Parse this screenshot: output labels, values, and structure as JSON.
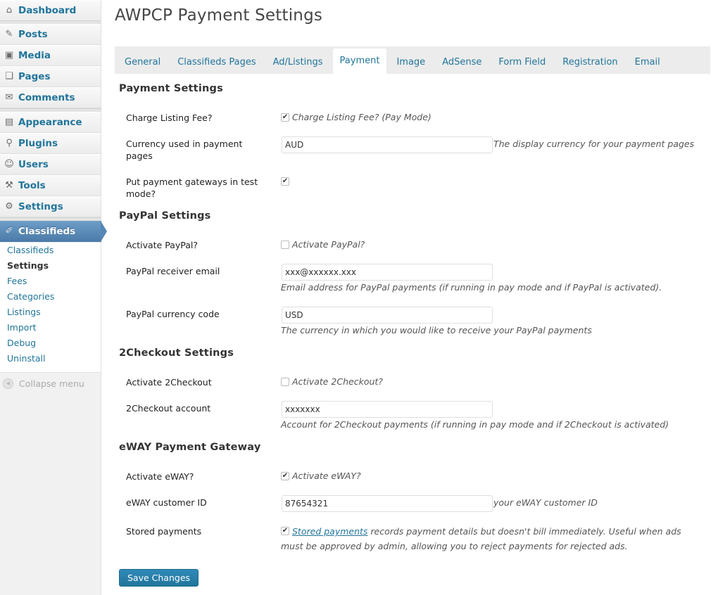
{
  "sidebar": {
    "items": [
      {
        "label": "Dashboard",
        "icon": "dashboard-icon"
      },
      {
        "label": "Posts",
        "icon": "posts-icon"
      },
      {
        "label": "Media",
        "icon": "media-icon"
      },
      {
        "label": "Pages",
        "icon": "pages-icon"
      },
      {
        "label": "Comments",
        "icon": "comments-icon"
      },
      {
        "label": "Appearance",
        "icon": "appearance-icon"
      },
      {
        "label": "Plugins",
        "icon": "plugins-icon"
      },
      {
        "label": "Users",
        "icon": "users-icon"
      },
      {
        "label": "Tools",
        "icon": "tools-icon"
      },
      {
        "label": "Settings",
        "icon": "settings-icon"
      },
      {
        "label": "Classifieds",
        "icon": "classifieds-icon"
      }
    ],
    "submenu": [
      "Classifieds",
      "Settings",
      "Fees",
      "Categories",
      "Listings",
      "Import",
      "Debug",
      "Uninstall"
    ],
    "collapse_label": "Collapse menu"
  },
  "page": {
    "title": "AWPCP Payment Settings"
  },
  "tabs": [
    "General",
    "Classifieds Pages",
    "Ad/Listings",
    "Payment",
    "Image",
    "AdSense",
    "Form Field",
    "Registration",
    "Email"
  ],
  "active_tab": "Payment",
  "sections": {
    "payment": {
      "title": "Payment Settings",
      "charge_fee_label": "Charge Listing Fee?",
      "charge_fee_text": "Charge Listing Fee? (Pay Mode)",
      "charge_fee_checked": true,
      "currency_label": "Currency used in payment pages",
      "currency_value": "AUD",
      "currency_desc": "The display currency for your payment pages",
      "test_mode_label": "Put payment gateways in test mode?",
      "test_mode_checked": true
    },
    "paypal": {
      "title": "PayPal Settings",
      "activate_label": "Activate PayPal?",
      "activate_text": "Activate PayPal?",
      "activate_checked": false,
      "email_label": "PayPal receiver email",
      "email_value": "xxx@xxxxxx.xxx",
      "email_desc": "Email address for PayPal payments (if running in pay mode and if PayPal is activated).",
      "currency_label": "PayPal currency code",
      "currency_value": "USD",
      "currency_desc": "The currency in which you would like to receive your PayPal payments"
    },
    "twocheckout": {
      "title": "2Checkout Settings",
      "activate_label": "Activate 2Checkout",
      "activate_text": "Activate 2Checkout?",
      "activate_checked": false,
      "account_label": "2Checkout account",
      "account_value": "xxxxxxx",
      "account_desc": "Account for 2Checkout payments (if running in pay mode and if 2Checkout is activated)"
    },
    "eway": {
      "title": "eWAY Payment Gateway",
      "activate_label": "Activate eWAY?",
      "activate_text": "Activate eWAY?",
      "activate_checked": true,
      "customer_label": "eWAY customer ID",
      "customer_value": "87654321",
      "customer_desc": "your eWAY customer ID",
      "stored_label": "Stored payments",
      "stored_checked": true,
      "stored_link": "Stored payments",
      "stored_desc": " records payment details but doesn't bill immediately. Useful when ads must be approved by admin, allowing you to reject payments for rejected ads."
    }
  },
  "save_label": "Save Changes",
  "colors": {
    "link": "#21759b",
    "active_menu": "#5688b7",
    "button": "#21759b"
  }
}
